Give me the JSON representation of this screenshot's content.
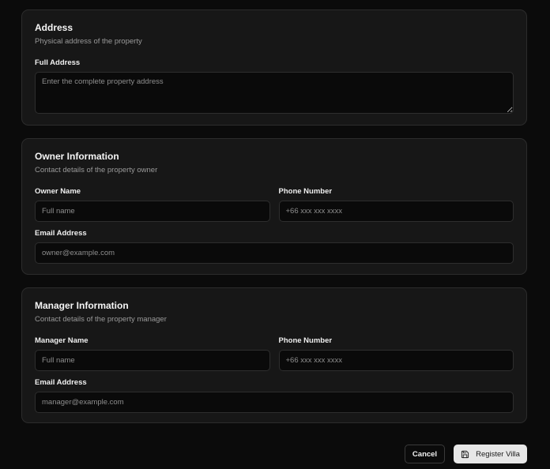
{
  "address": {
    "title": "Address",
    "description": "Physical address of the property",
    "full_address_label": "Full Address",
    "full_address_placeholder": "Enter the complete property address"
  },
  "owner": {
    "title": "Owner Information",
    "description": "Contact details of the property owner",
    "name_label": "Owner Name",
    "name_placeholder": "Full name",
    "phone_label": "Phone Number",
    "phone_placeholder": "+66 xxx xxx xxxx",
    "email_label": "Email Address",
    "email_placeholder": "owner@example.com"
  },
  "manager": {
    "title": "Manager Information",
    "description": "Contact details of the property manager",
    "name_label": "Manager Name",
    "name_placeholder": "Full name",
    "phone_label": "Phone Number",
    "phone_placeholder": "+66 xxx xxx xxxx",
    "email_label": "Email Address",
    "email_placeholder": "manager@example.com"
  },
  "actions": {
    "cancel_label": "Cancel",
    "register_label": "Register Villa",
    "register_icon": "save-icon"
  }
}
